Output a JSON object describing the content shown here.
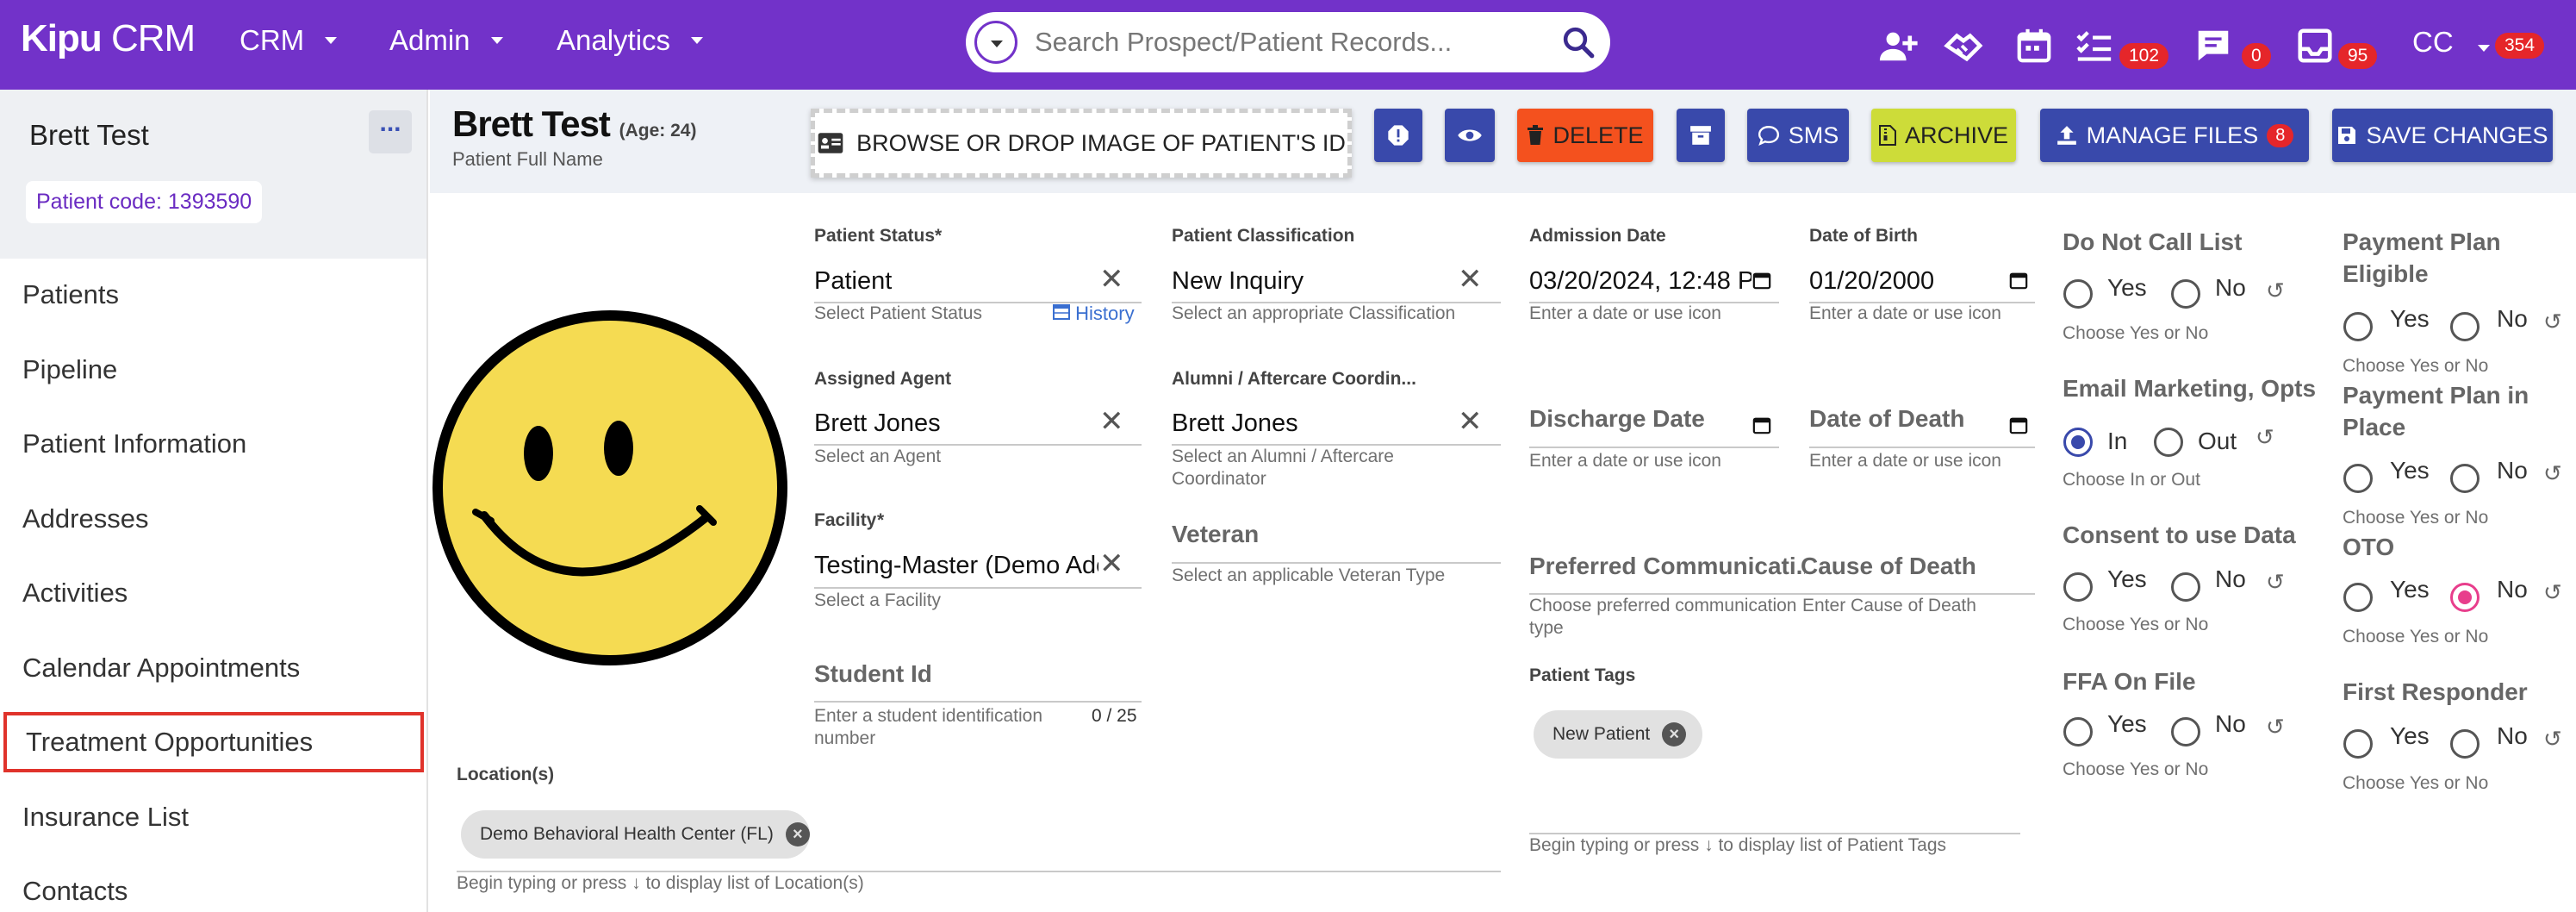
{
  "nav": {
    "logo_bold": "Kipu",
    "logo_rest": " CRM",
    "menus": [
      {
        "label": "CRM"
      },
      {
        "label": "Admin"
      },
      {
        "label": "Analytics"
      }
    ],
    "search_placeholder": "Search Prospect/Patient Records...",
    "badges": {
      "tasks": "102",
      "messages": "0",
      "inbox": "95",
      "user": "354"
    },
    "user_initials": "CC"
  },
  "sidebar": {
    "patient_name": "Brett Test",
    "more": "...",
    "patient_code": "Patient code: 1393590",
    "items": [
      {
        "label": "Patients"
      },
      {
        "label": "Pipeline"
      },
      {
        "label": "Patient Information"
      },
      {
        "label": "Addresses"
      },
      {
        "label": "Activities"
      },
      {
        "label": "Calendar Appointments"
      },
      {
        "label": "Treatment Opportunities"
      },
      {
        "label": "Insurance List"
      },
      {
        "label": "Contacts"
      }
    ],
    "active_item": "Treatment Opportunities"
  },
  "header": {
    "name": "Brett Test",
    "age": "(Age: 24)",
    "sub": "Patient Full Name",
    "browse_label": "BROWSE OR DROP IMAGE OF PATIENT'S ID",
    "delete_label": "DELETE",
    "sms_label": "SMS",
    "archive_label": "ARCHIVE",
    "manage_files_label": "MANAGE FILES",
    "manage_files_count": "8",
    "save_label": "SAVE CHANGES",
    "colors": {
      "delete": "#f4511e",
      "archive": "#cddc39",
      "primary": "#3949ab",
      "nav": "#7232c9"
    }
  },
  "form": {
    "patient_status": {
      "label": "Patient Status",
      "value": "Patient",
      "help": "Select Patient Status",
      "history": "History"
    },
    "classification": {
      "label": "Patient Classification",
      "value": "New Inquiry",
      "help": "Select an appropriate Classification"
    },
    "admission_date": {
      "label": "Admission Date",
      "value": "03/20/2024, 12:48 P",
      "help": "Enter a date or use icon"
    },
    "dob": {
      "label": "Date of Birth",
      "value": "01/20/2000",
      "help": "Enter a date or use icon"
    },
    "assigned_agent": {
      "label": "Assigned Agent",
      "value": "Brett Jones",
      "help": "Select an Agent"
    },
    "alumni": {
      "label": "Alumni / Aftercare Coordin...",
      "value": "Brett Jones",
      "help": "Select an Alumni / Aftercare Coordinator"
    },
    "discharge_date": {
      "label": "Discharge Date",
      "help": "Enter a date or use icon"
    },
    "date_of_death": {
      "label": "Date of Death",
      "help": "Enter a date or use icon"
    },
    "facility": {
      "label": "Facility",
      "value": "Testing-Master (Demo Adol",
      "help": "Select a Facility"
    },
    "veteran": {
      "label": "Veteran",
      "help": "Select an applicable Veteran Type"
    },
    "preferred_comm": {
      "label": "Preferred Communicati...",
      "help": "Choose preferred communication type"
    },
    "cause_of_death": {
      "label": "Cause of Death",
      "help": "Enter Cause of Death"
    },
    "student_id": {
      "label": "Student Id",
      "help": "Enter a student identification number",
      "counter": "0 / 25"
    },
    "patient_tags": {
      "label": "Patient Tags",
      "chip": "New Patient",
      "help": "Begin typing or press ↓ to display list of Patient Tags"
    },
    "locations": {
      "label": "Location(s)",
      "chip": "Demo Behavioral Health Center (FL)",
      "help": "Begin typing or press ↓ to display list of Location(s)"
    }
  },
  "toggles": {
    "do_not_call": {
      "label": "Do Not Call List",
      "yes": "Yes",
      "no": "No",
      "help": "Choose Yes or No",
      "selected": "none"
    },
    "email_marketing": {
      "label": "Email Marketing, Opts",
      "yes": "In",
      "no": "Out",
      "help": "Choose In or Out",
      "selected": "In"
    },
    "consent": {
      "label": "Consent to use Data",
      "yes": "Yes",
      "no": "No",
      "help": "Choose Yes or No",
      "selected": "none"
    },
    "ffa": {
      "label": "FFA On File",
      "yes": "Yes",
      "no": "No",
      "help": "Choose Yes or No",
      "selected": "none"
    },
    "payment_plan_eligible": {
      "label1": "Payment Plan",
      "label2": "Eligible",
      "yes": "Yes",
      "no": "No",
      "help": "Choose Yes or No",
      "selected": "none"
    },
    "payment_plan_in_place": {
      "label1": "Payment Plan in",
      "label2": "Place",
      "yes": "Yes",
      "no": "No",
      "help": "Choose Yes or No",
      "selected": "none"
    },
    "oto": {
      "label": "OTO",
      "yes": "Yes",
      "no": "No",
      "help": "Choose Yes or No",
      "selected": "No"
    },
    "first_responder": {
      "label": "First Responder",
      "yes": "Yes",
      "no": "No",
      "help": "Choose Yes or No",
      "selected": "none"
    }
  }
}
